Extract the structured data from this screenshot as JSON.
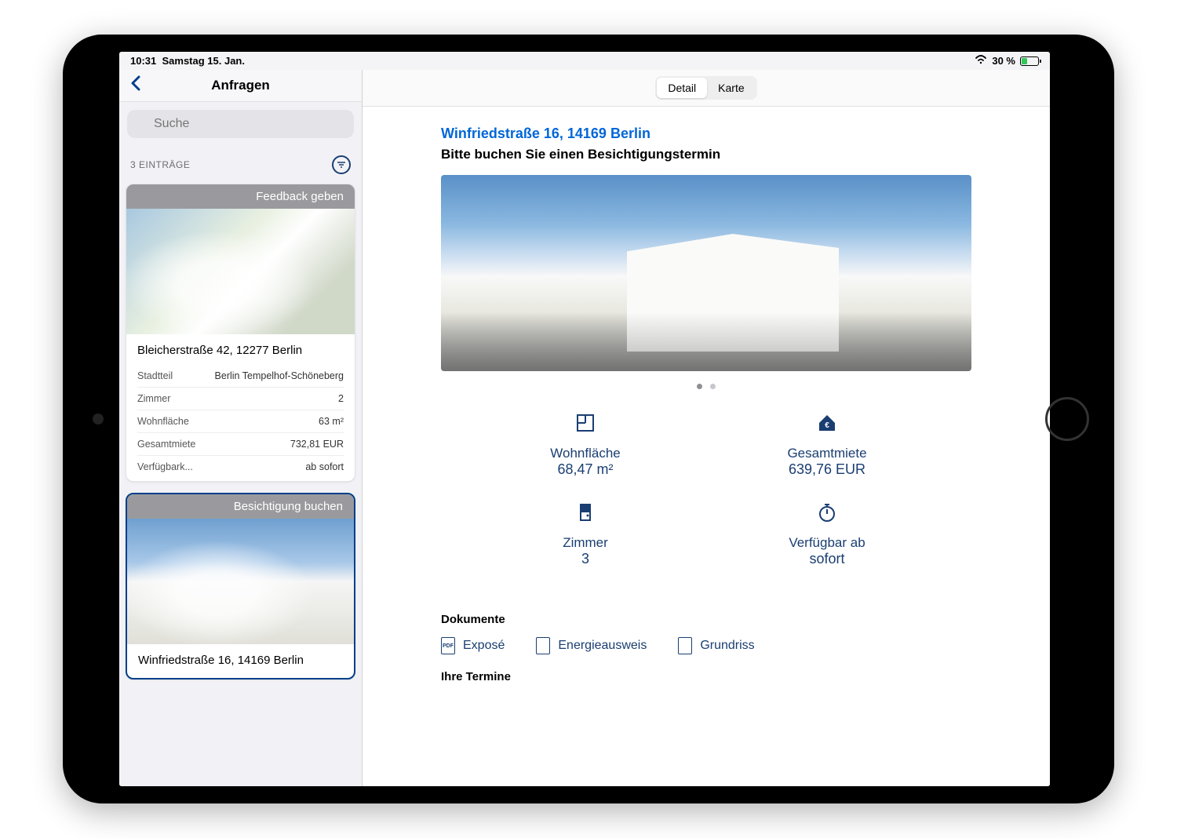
{
  "status": {
    "time": "10:31",
    "date": "Samstag 15. Jan.",
    "battery": "30 %"
  },
  "sidebar": {
    "title": "Anfragen",
    "search_placeholder": "Suche",
    "entries_label": "3 EINTRÄGE",
    "cards": [
      {
        "banner": "Feedback geben",
        "address": "Bleicherstraße 42, 12277 Berlin",
        "rows": [
          {
            "label": "Stadtteil",
            "value": "Berlin Tempelhof-Schöneberg"
          },
          {
            "label": "Zimmer",
            "value": "2"
          },
          {
            "label": "Wohnfläche",
            "value": "63 m²"
          },
          {
            "label": "Gesamtmiete",
            "value": "732,81 EUR"
          },
          {
            "label": "Verfügbark...",
            "value": "ab sofort"
          }
        ]
      },
      {
        "banner": "Besichtigung buchen",
        "address": "Winfriedstraße 16, 14169 Berlin"
      }
    ]
  },
  "detail": {
    "tabs": {
      "detail": "Detail",
      "karte": "Karte"
    },
    "address": "Winfriedstraße 16, 14169 Berlin",
    "subtitle": "Bitte buchen Sie einen Besichtigungstermin",
    "stats": [
      {
        "label": "Wohnfläche",
        "value": "68,47 m²"
      },
      {
        "label": "Gesamtmiete",
        "value": "639,76 EUR"
      },
      {
        "label": "Zimmer",
        "value": "3"
      },
      {
        "label": "Verfügbar ab",
        "value": "sofort"
      }
    ],
    "documents_title": "Dokumente",
    "documents": [
      {
        "label": "Exposé",
        "icon": "PDF"
      },
      {
        "label": "Energieausweis",
        "icon": ""
      },
      {
        "label": "Grundriss",
        "icon": ""
      }
    ],
    "appointments_title": "Ihre Termine"
  }
}
